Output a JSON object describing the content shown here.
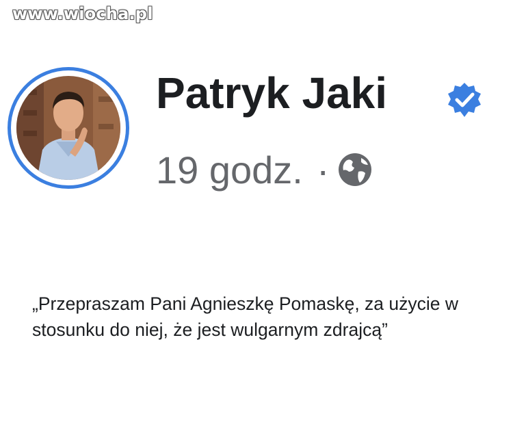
{
  "watermark": "www.wiocha.pl",
  "post": {
    "author": "Patryk Jaki",
    "verified": true,
    "timestamp": "19 godz.",
    "separator": "·",
    "privacy_icon": "globe-icon",
    "text": "„Przepraszam Pani Agnieszkę Pomaskę, za użycie w stosunku do niej, że jest wulgarnym zdrajcą”"
  },
  "colors": {
    "accent": "#3b7fe0",
    "name": "#1c1e21",
    "meta": "#65676b"
  }
}
